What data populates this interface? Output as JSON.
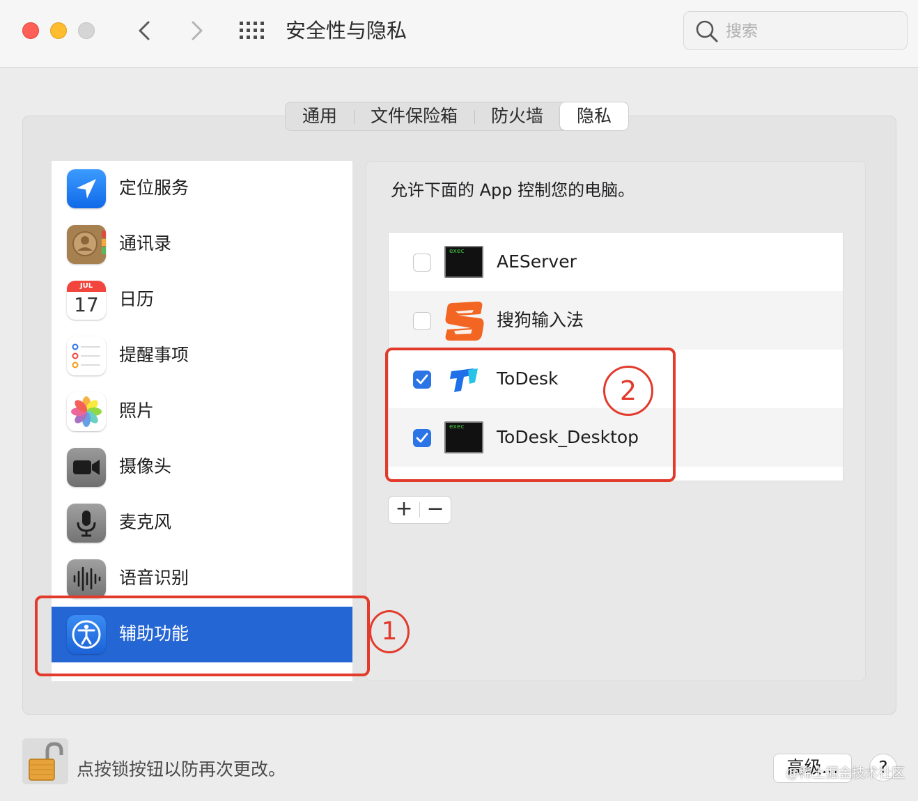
{
  "window": {
    "title": "安全性与隐私",
    "search_placeholder": "搜索"
  },
  "tabs": [
    {
      "label": "通用",
      "active": false
    },
    {
      "label": "文件保险箱",
      "active": false
    },
    {
      "label": "防火墙",
      "active": false
    },
    {
      "label": "隐私",
      "active": true
    }
  ],
  "sidebar": {
    "items": [
      {
        "label": "定位服务",
        "icon": "location-arrow-icon"
      },
      {
        "label": "通讯录",
        "icon": "contacts-icon"
      },
      {
        "label": "日历",
        "icon": "calendar-icon",
        "month": "JUL",
        "day": "17"
      },
      {
        "label": "提醒事项",
        "icon": "reminders-icon"
      },
      {
        "label": "照片",
        "icon": "photos-icon"
      },
      {
        "label": "摄像头",
        "icon": "camera-icon"
      },
      {
        "label": "麦克风",
        "icon": "microphone-icon"
      },
      {
        "label": "语音识别",
        "icon": "speech-recognition-icon"
      },
      {
        "label": "辅助功能",
        "icon": "accessibility-icon",
        "selected": true
      }
    ]
  },
  "main": {
    "description": "允许下面的 App 控制您的电脑。",
    "apps": [
      {
        "name": "AEServer",
        "checked": false,
        "icon": "exec-terminal-icon",
        "icon_text": "exec"
      },
      {
        "name": "搜狗输入法",
        "checked": false,
        "icon": "sogou-icon"
      },
      {
        "name": "ToDesk",
        "checked": true,
        "icon": "todesk-icon"
      },
      {
        "name": "ToDesk_Desktop",
        "checked": true,
        "icon": "exec-terminal-icon",
        "icon_text": "exec"
      }
    ],
    "add_label": "+",
    "remove_label": "−"
  },
  "annotations": {
    "marker1": "1",
    "marker2": "2",
    "color": "#e23a2b"
  },
  "footer": {
    "lock_text": "点按锁按钮以防再次更改。",
    "advanced_label": "高级...",
    "help_label": "?",
    "watermark": "@稀土掘金技术社区"
  },
  "colors": {
    "selection": "#2566d5",
    "checkbox": "#2a74e6"
  }
}
